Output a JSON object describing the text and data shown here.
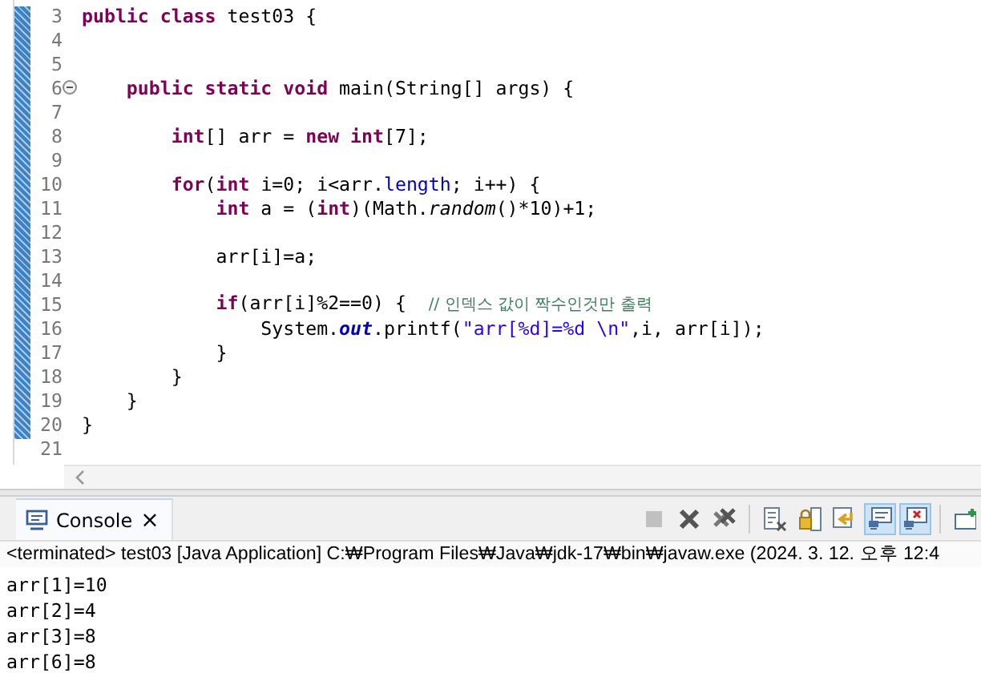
{
  "editor": {
    "lines": [
      {
        "number": "3",
        "foldable": false,
        "tokens": [
          {
            "kind": "keyword",
            "text": "public class"
          },
          {
            "kind": "plain",
            "text": " test03 {"
          }
        ]
      },
      {
        "number": "4",
        "foldable": false
      },
      {
        "number": "5",
        "foldable": false
      },
      {
        "number": "6",
        "foldable": true,
        "tokens": [
          {
            "kind": "keyword",
            "text": "    public static void"
          },
          {
            "kind": "plain",
            "text": " main(String[] args) {"
          }
        ]
      },
      {
        "number": "7",
        "foldable": false
      },
      {
        "number": "8",
        "foldable": false,
        "tokens": [
          {
            "kind": "keyword",
            "text": "        int"
          },
          {
            "kind": "plain",
            "text": "[] arr = "
          },
          {
            "kind": "keyword",
            "text": "new int"
          },
          {
            "kind": "plain",
            "text": "[7];"
          }
        ]
      },
      {
        "number": "9",
        "foldable": false
      },
      {
        "number": "10",
        "foldable": false,
        "tokens": [
          {
            "kind": "keyword",
            "text": "        for"
          },
          {
            "kind": "plain",
            "text": "("
          },
          {
            "kind": "keyword",
            "text": "int"
          },
          {
            "kind": "plain",
            "text": " i=0; i<arr."
          },
          {
            "kind": "field",
            "text": "length"
          },
          {
            "kind": "plain",
            "text": "; i++) {"
          }
        ]
      },
      {
        "number": "11",
        "foldable": false,
        "tokens": [
          {
            "kind": "keyword",
            "text": "            int"
          },
          {
            "kind": "plain",
            "text": " a = ("
          },
          {
            "kind": "keyword",
            "text": "int"
          },
          {
            "kind": "plain",
            "text": ")(Math."
          },
          {
            "kind": "static",
            "text": "random"
          },
          {
            "kind": "plain",
            "text": "()*10)+1;"
          }
        ]
      },
      {
        "number": "12",
        "foldable": false
      },
      {
        "number": "13",
        "foldable": false,
        "tokens": [
          {
            "kind": "plain",
            "text": "            arr[i]=a;"
          }
        ]
      },
      {
        "number": "14",
        "foldable": false
      },
      {
        "number": "15",
        "foldable": false,
        "tokens": [
          {
            "kind": "keyword",
            "text": "            if"
          },
          {
            "kind": "plain",
            "text": "(arr[i]%2==0) {  "
          },
          {
            "kind": "comment",
            "text": "// 인덱스 값이 짝수인것만 출력"
          }
        ]
      },
      {
        "number": "16",
        "foldable": false,
        "tokens": [
          {
            "kind": "plain",
            "text": "                System."
          },
          {
            "kind": "staticfield",
            "text": "out"
          },
          {
            "kind": "plain",
            "text": ".printf("
          },
          {
            "kind": "string",
            "text": "\"arr[%d]=%d \\n\""
          },
          {
            "kind": "plain",
            "text": ",i, arr[i]);"
          }
        ]
      },
      {
        "number": "17",
        "foldable": false,
        "tokens": [
          {
            "kind": "plain",
            "text": "            }"
          }
        ]
      },
      {
        "number": "18",
        "foldable": false,
        "tokens": [
          {
            "kind": "plain",
            "text": "        }"
          }
        ]
      },
      {
        "number": "19",
        "foldable": false,
        "tokens": [
          {
            "kind": "plain",
            "text": "    }"
          }
        ]
      },
      {
        "number": "20",
        "foldable": false,
        "tokens": [
          {
            "kind": "plain",
            "text": "}"
          }
        ]
      },
      {
        "number": "21",
        "foldable": false
      }
    ]
  },
  "console": {
    "tab": {
      "label": "Console",
      "close": "×",
      "selected": true
    },
    "toolbar": [
      {
        "kind": "terminate",
        "disabled": true,
        "pressed": false
      },
      {
        "kind": "remove",
        "disabled": false,
        "pressed": false
      },
      {
        "kind": "remove-all",
        "disabled": false,
        "pressed": false
      },
      {
        "kind": "clear",
        "disabled": false,
        "pressed": false
      },
      {
        "kind": "scroll-lock",
        "disabled": false,
        "pressed": false
      },
      {
        "kind": "word-wrap",
        "disabled": false,
        "pressed": false
      },
      {
        "kind": "show-stdout",
        "disabled": false,
        "pressed": true
      },
      {
        "kind": "show-stderr",
        "disabled": false,
        "pressed": true
      },
      {
        "kind": "open-console",
        "disabled": false,
        "pressed": false
      }
    ],
    "status": "<terminated> test03 [Java Application] C:₩Program Files₩Java₩jdk-17₩bin₩javaw.exe  (2024. 3. 12. 오후 12:4",
    "output": [
      "arr[1]=10",
      "arr[2]=4",
      "arr[3]=8",
      "arr[6]=8"
    ]
  }
}
